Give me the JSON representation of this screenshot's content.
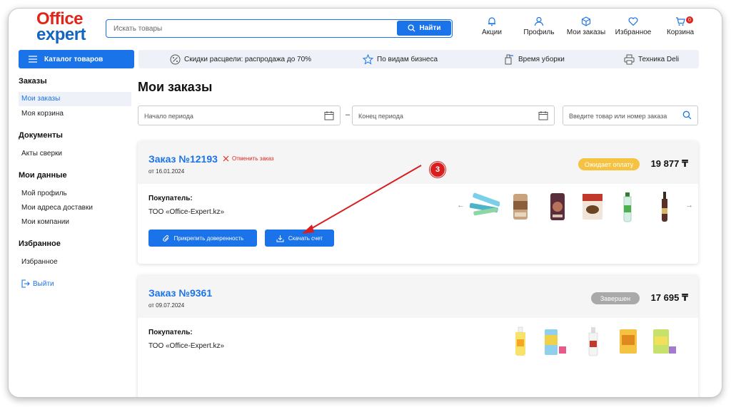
{
  "header": {
    "logo_line1": "Office",
    "logo_line2": "expert",
    "search_placeholder": "Искать товары",
    "search_button": "Найти",
    "nav": [
      {
        "label": "Акции",
        "icon": "bell-icon"
      },
      {
        "label": "Профиль",
        "icon": "user-icon"
      },
      {
        "label": "Мои заказы",
        "icon": "box-icon"
      },
      {
        "label": "Избранное",
        "icon": "heart-icon"
      },
      {
        "label": "Корзина",
        "icon": "cart-icon",
        "badge": "0"
      }
    ]
  },
  "catalog_button": "Каталог товаров",
  "promo": [
    {
      "label": "Скидки расцвели: распродажа до 70%",
      "icon": "percent-icon"
    },
    {
      "label": "По видам бизнеса",
      "icon": "star-icon"
    },
    {
      "label": "Время уборки",
      "icon": "cleaning-icon"
    },
    {
      "label": "Техника Deli",
      "icon": "printer-icon"
    }
  ],
  "sidebar": {
    "sections": [
      {
        "title": "Заказы",
        "items": [
          "Мои заказы",
          "Моя корзина"
        ]
      },
      {
        "title": "Документы",
        "items": [
          "Акты сверки"
        ]
      },
      {
        "title": "Мои данные",
        "items": [
          "Мой профиль",
          "Мои адреса доставки",
          "Мои компании"
        ]
      },
      {
        "title": "Избранное",
        "items": [
          "Избранное"
        ]
      }
    ],
    "active_item": "Мои заказы",
    "logout": "Выйти"
  },
  "main": {
    "title": "Мои заказы",
    "filters": {
      "start_placeholder": "Начало периода",
      "end_placeholder": "Конец периода",
      "search_placeholder": "Введите товар или номер заказа",
      "separator": "–"
    },
    "orders": [
      {
        "title": "Заказ №12193",
        "date": "от 16.01.2024",
        "cancel_label": "Отменить заказ",
        "status": "Ожидает оплату",
        "status_color": "#f5c242",
        "price": "19 877 ₸",
        "buyer_label": "Покупатель:",
        "buyer": "ТОО «Office-Expert.kz»",
        "buttons": [
          "Прикрепить доверенность",
          "Скачать счет"
        ]
      },
      {
        "title": "Заказ №9361",
        "date": "от 09.07.2024",
        "status": "Завершен",
        "status_color": "#a9a9a9",
        "price": "17 695 ₸",
        "buyer_label": "Покупатель:",
        "buyer": "ТОО «Office-Expert.kz»"
      }
    ]
  },
  "annotation": {
    "step": "3",
    "color": "#d81e1e"
  }
}
